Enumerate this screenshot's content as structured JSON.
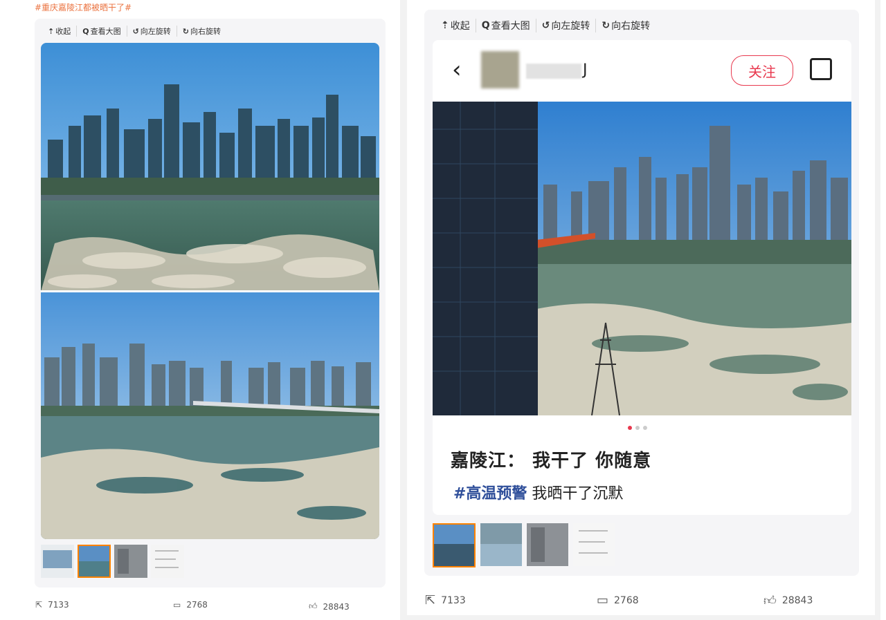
{
  "left": {
    "hashtag": "#重庆嘉陵江都被晒干了#",
    "toolbar": {
      "collapse": "收起",
      "view_large": "查看大图",
      "rotate_left": "向左旋转",
      "rotate_right": "向右旋转"
    },
    "footer": {
      "reposts": "7133",
      "comments": "2768",
      "likes": "28843"
    }
  },
  "right": {
    "toolbar": {
      "collapse": "收起",
      "view_large": "查看大图",
      "rotate_left": "向左旋转",
      "rotate_right": "向右旋转"
    },
    "card": {
      "username_suffix": "J",
      "follow_label": "关注",
      "caption_title": "嘉陵江： 我干了 你随意",
      "caption_tag": "#高温预警",
      "caption_rest": " 我晒干了沉默"
    },
    "footer": {
      "reposts": "7133",
      "comments": "2768",
      "likes": "28843"
    }
  },
  "icons": {
    "collapse": "upload-arrow-icon",
    "view_large": "magnifier-icon",
    "rotate_left": "rotate-left-icon",
    "rotate_right": "rotate-right-icon",
    "repost": "share-box-icon",
    "comment": "comment-bubble-icon",
    "like": "thumbs-up-icon"
  },
  "colors": {
    "hashtag": "#eb7340",
    "thumb_active_border": "#ff8200",
    "follow": "#e8384e",
    "tag": "#2f4f9a"
  }
}
